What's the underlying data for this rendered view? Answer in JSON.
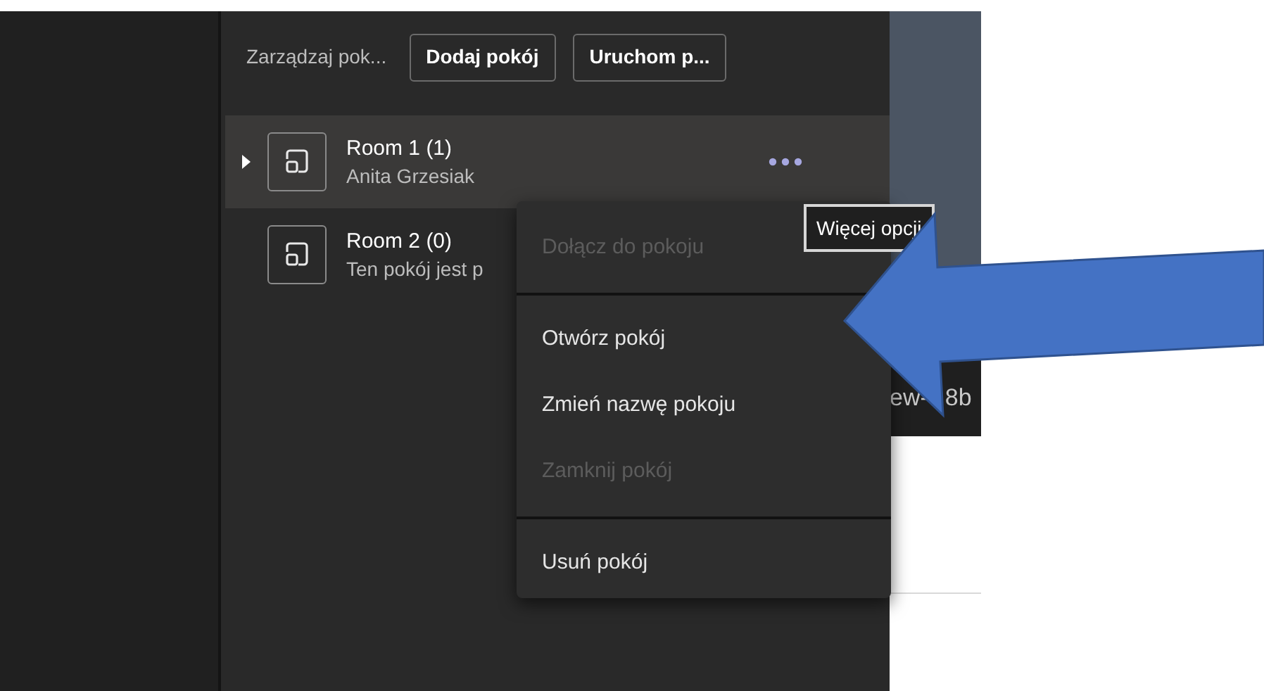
{
  "header": {
    "label": "Zarządzaj pok...",
    "buttons": [
      "Dodaj pokój",
      "Uruchom p..."
    ]
  },
  "rooms": [
    {
      "title": "Room 1 (1)",
      "subtitle": "Anita Grzesiak",
      "selected": true,
      "has_caret": true
    },
    {
      "title": "Room 2 (0)",
      "subtitle": "Ten pokój jest p",
      "selected": false,
      "has_caret": false
    }
  ],
  "tooltip": "Więcej opcji",
  "background_tab": [
    "ew-",
    "8b"
  ],
  "menu": [
    {
      "kind": "item",
      "label": "Dołącz do pokoju",
      "disabled": true
    },
    {
      "kind": "divider"
    },
    {
      "kind": "item",
      "label": "Otwórz pokój",
      "disabled": false
    },
    {
      "kind": "item",
      "label": "Zmień nazwę pokoju",
      "disabled": false
    },
    {
      "kind": "item",
      "label": "Zamknij pokój",
      "disabled": true
    },
    {
      "kind": "divider"
    },
    {
      "kind": "item",
      "label": "Usuń pokój",
      "disabled": false
    }
  ]
}
